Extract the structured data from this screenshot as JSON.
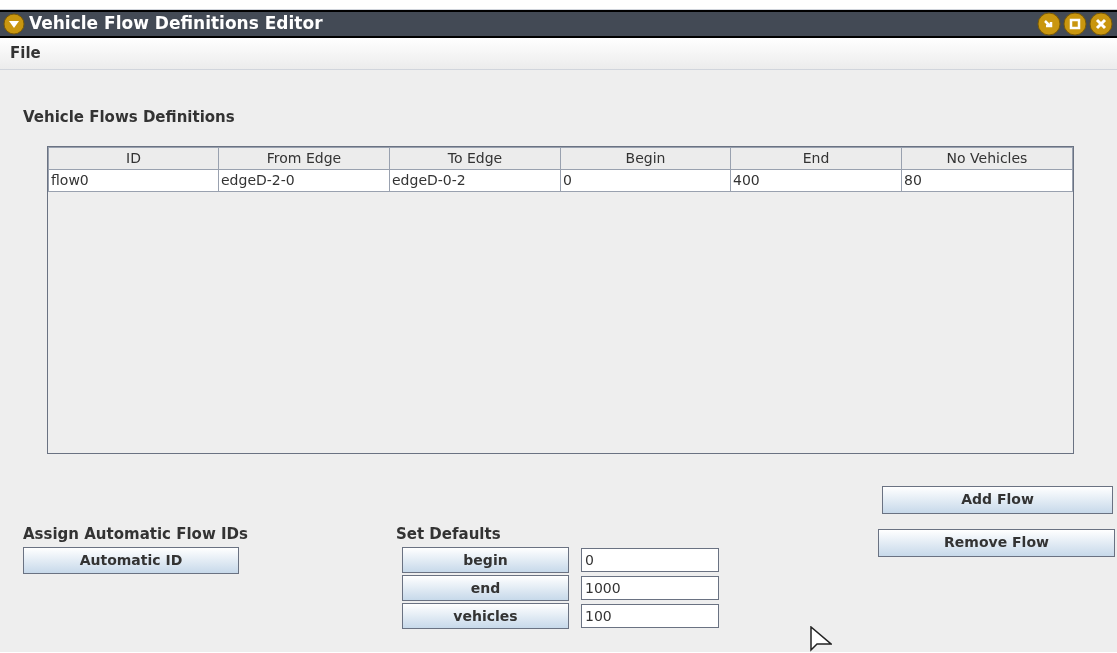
{
  "window": {
    "title": "Vehicle Flow Definitions Editor"
  },
  "menu": [
    "File"
  ],
  "table": {
    "title": "Vehicle Flows Definitions",
    "columns": [
      "ID",
      "From Edge",
      "To Edge",
      "Begin",
      "End",
      "No Vehicles"
    ],
    "rows": [
      [
        "flow0",
        "edgeD-2-0",
        "edgeD-0-2",
        "0",
        "400",
        "80"
      ]
    ]
  },
  "flow_buttons": [
    "Add Flow",
    "Remove Flow"
  ],
  "auto_ids": {
    "title": "Assign Automatic Flow IDs",
    "button": "Automatic ID"
  },
  "defaults": {
    "title": "Set Defaults",
    "items": [
      {
        "button": "begin",
        "value": "0"
      },
      {
        "button": "end",
        "value": "1000"
      },
      {
        "button": "vehicles",
        "value": "100"
      }
    ]
  }
}
